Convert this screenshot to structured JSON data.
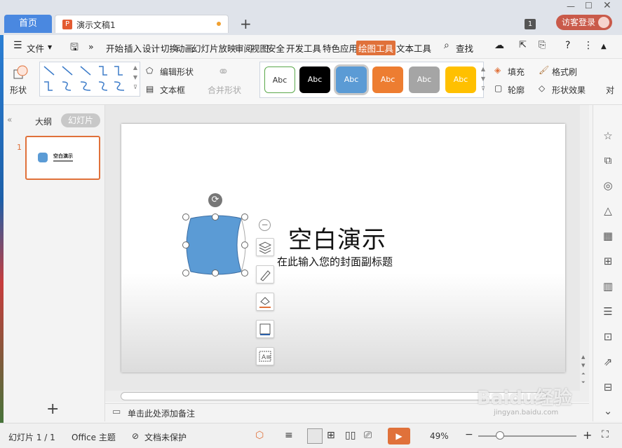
{
  "titlebar": {
    "home_tab": "首页",
    "doc_tab": "演示文稿1",
    "doc_icon": "P",
    "new_tab": "+",
    "window_count": "1",
    "login": "访客登录"
  },
  "menu": {
    "file": "文件",
    "more": "»",
    "items": [
      "开始",
      "插入",
      "设计",
      "切换",
      "动画",
      "幻灯片放映",
      "审阅",
      "视图",
      "安全",
      "开发工具",
      "特色应用",
      "绘图工具",
      "文本工具"
    ],
    "active": "绘图工具",
    "search": "查找"
  },
  "ribbon": {
    "shape": "形状",
    "edit_shape": "编辑形状",
    "textbox": "文本框",
    "merge_shape": "合并形状",
    "style_labels": [
      "Abc",
      "Abc",
      "Abc",
      "Abc",
      "Abc",
      "Abc"
    ],
    "fill": "填充",
    "format_painter": "格式刷",
    "outline": "轮廓",
    "shape_effects": "形状效果",
    "align": "对"
  },
  "left_panel": {
    "outline_tab": "大纲",
    "slides_tab": "幻灯片",
    "slide_number": "1",
    "thumb_title": "空白演示",
    "add": "+"
  },
  "slide": {
    "title": "空白演示",
    "subtitle": "在此输入您的封面副标题"
  },
  "notes": {
    "placeholder": "单击此处添加备注"
  },
  "status": {
    "slide_info": "幻灯片 1 / 1",
    "theme": "Office 主题",
    "protect": "文档未保护",
    "zoom": "49%"
  },
  "watermark": {
    "text": "Baidu经验",
    "sub": "jingyan.baidu.com"
  },
  "colors": {
    "accent": "#e0713a",
    "shape_fill": "#5b9bd5",
    "home_tab": "#4a88e0"
  }
}
